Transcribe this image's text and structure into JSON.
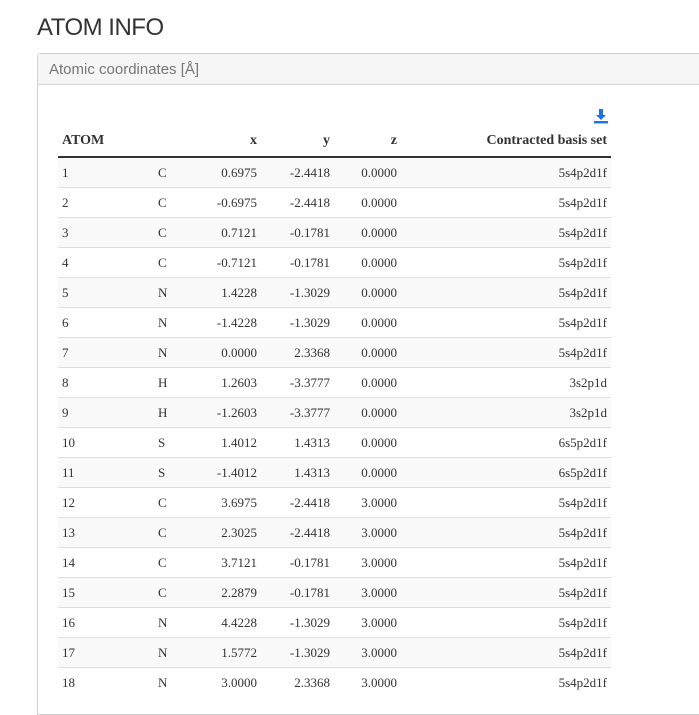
{
  "page": {
    "title": "ATOM INFO"
  },
  "panel": {
    "heading": "Atomic coordinates [Å]"
  },
  "download": {
    "icon": "download-icon",
    "color": "#1a73e8"
  },
  "table": {
    "headers": {
      "atom": "ATOM",
      "element": "",
      "x": "x",
      "y": "y",
      "z": "z",
      "basis": "Contracted basis set"
    },
    "rows": [
      {
        "idx": "1",
        "el": "C",
        "x": "0.6975",
        "y": "-2.4418",
        "z": "0.0000",
        "basis": "5s4p2d1f"
      },
      {
        "idx": "2",
        "el": "C",
        "x": "-0.6975",
        "y": "-2.4418",
        "z": "0.0000",
        "basis": "5s4p2d1f"
      },
      {
        "idx": "3",
        "el": "C",
        "x": "0.7121",
        "y": "-0.1781",
        "z": "0.0000",
        "basis": "5s4p2d1f"
      },
      {
        "idx": "4",
        "el": "C",
        "x": "-0.7121",
        "y": "-0.1781",
        "z": "0.0000",
        "basis": "5s4p2d1f"
      },
      {
        "idx": "5",
        "el": "N",
        "x": "1.4228",
        "y": "-1.3029",
        "z": "0.0000",
        "basis": "5s4p2d1f"
      },
      {
        "idx": "6",
        "el": "N",
        "x": "-1.4228",
        "y": "-1.3029",
        "z": "0.0000",
        "basis": "5s4p2d1f"
      },
      {
        "idx": "7",
        "el": "N",
        "x": "0.0000",
        "y": "2.3368",
        "z": "0.0000",
        "basis": "5s4p2d1f"
      },
      {
        "idx": "8",
        "el": "H",
        "x": "1.2603",
        "y": "-3.3777",
        "z": "0.0000",
        "basis": "3s2p1d"
      },
      {
        "idx": "9",
        "el": "H",
        "x": "-1.2603",
        "y": "-3.3777",
        "z": "0.0000",
        "basis": "3s2p1d"
      },
      {
        "idx": "10",
        "el": "S",
        "x": "1.4012",
        "y": "1.4313",
        "z": "0.0000",
        "basis": "6s5p2d1f"
      },
      {
        "idx": "11",
        "el": "S",
        "x": "-1.4012",
        "y": "1.4313",
        "z": "0.0000",
        "basis": "6s5p2d1f"
      },
      {
        "idx": "12",
        "el": "C",
        "x": "3.6975",
        "y": "-2.4418",
        "z": "3.0000",
        "basis": "5s4p2d1f"
      },
      {
        "idx": "13",
        "el": "C",
        "x": "2.3025",
        "y": "-2.4418",
        "z": "3.0000",
        "basis": "5s4p2d1f"
      },
      {
        "idx": "14",
        "el": "C",
        "x": "3.7121",
        "y": "-0.1781",
        "z": "3.0000",
        "basis": "5s4p2d1f"
      },
      {
        "idx": "15",
        "el": "C",
        "x": "2.2879",
        "y": "-0.1781",
        "z": "3.0000",
        "basis": "5s4p2d1f"
      },
      {
        "idx": "16",
        "el": "N",
        "x": "4.4228",
        "y": "-1.3029",
        "z": "3.0000",
        "basis": "5s4p2d1f"
      },
      {
        "idx": "17",
        "el": "N",
        "x": "1.5772",
        "y": "-1.3029",
        "z": "3.0000",
        "basis": "5s4p2d1f"
      },
      {
        "idx": "18",
        "el": "N",
        "x": "3.0000",
        "y": "2.3368",
        "z": "3.0000",
        "basis": "5s4p2d1f"
      }
    ]
  }
}
